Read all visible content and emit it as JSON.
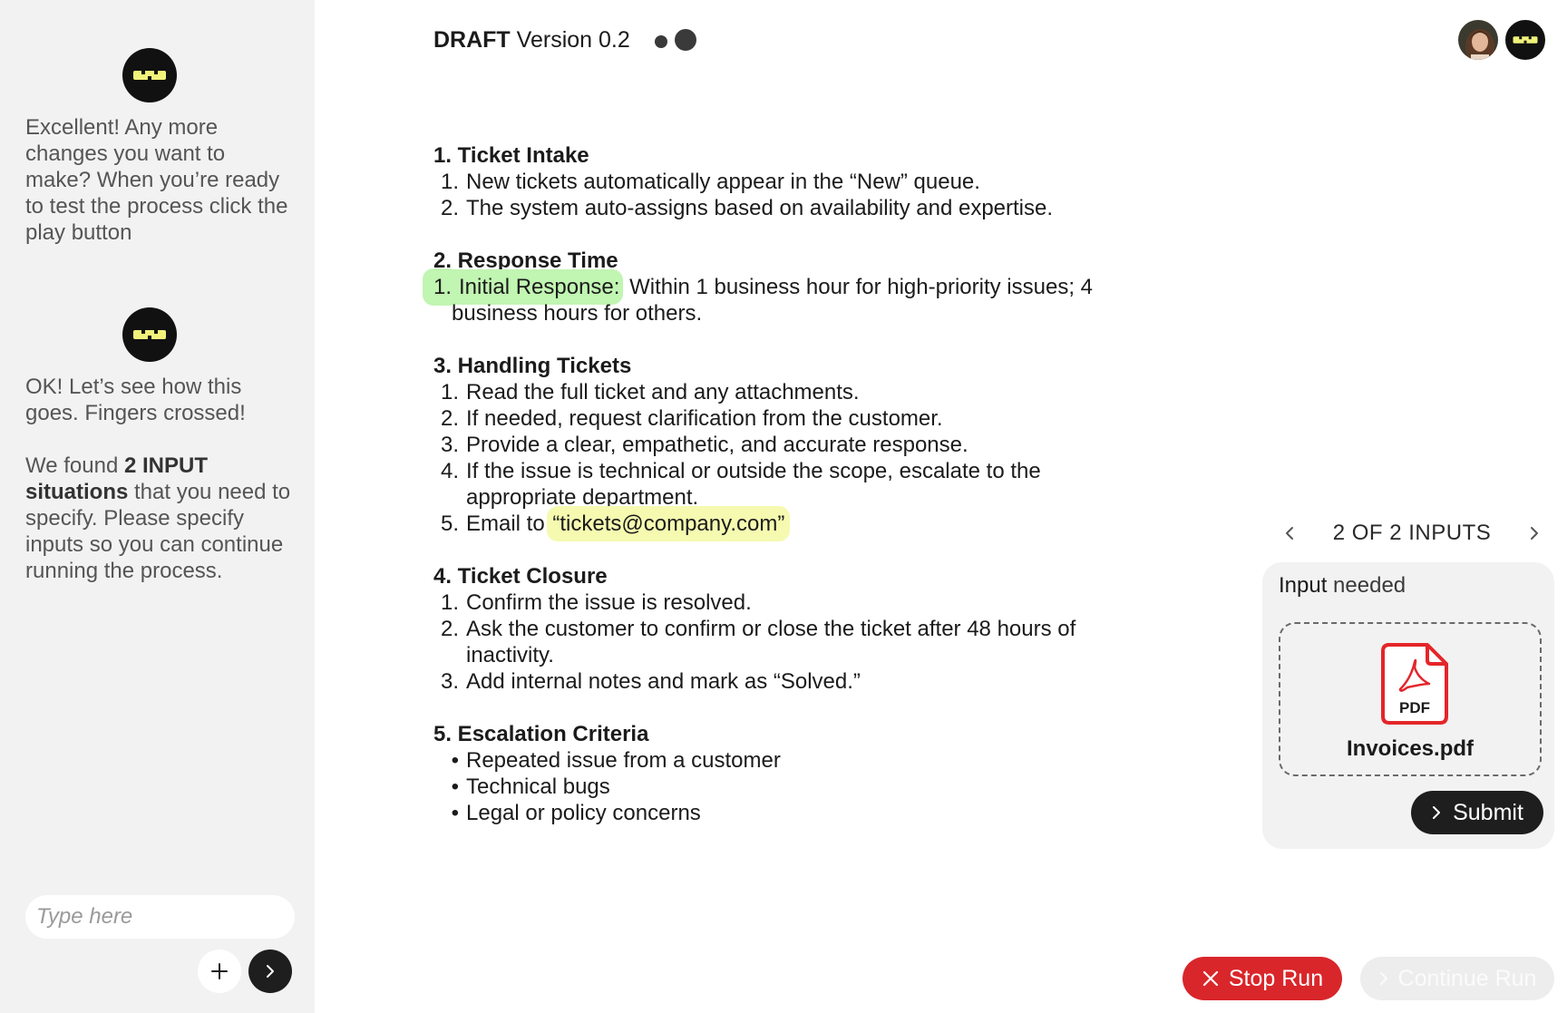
{
  "sidebar": {
    "messages": [
      {
        "text": "Excellent! Any more changes you want to make? When you’re ready to test the process click the play button"
      },
      {
        "line1": "OK! Let’s see how this goes. Fingers crossed!",
        "found_prefix": "We found ",
        "found_bold": "2 INPUT situations",
        "found_suffix": " that you need to specify. Please specify inputs so you can continue running the process."
      }
    ],
    "input_placeholder": "Type here",
    "plus_icon": "plus-icon",
    "send_icon": "chevron-right-icon"
  },
  "header": {
    "title_strong": "DRAFT",
    "title_rest": " Version 0.2"
  },
  "document": {
    "sections": [
      {
        "title": "1. Ticket Intake",
        "items": [
          {
            "num": "1.",
            "text": "New tickets automatically appear in the “New” queue."
          },
          {
            "num": "2.",
            "text": "The system auto-assigns based on availability and expertise."
          }
        ]
      },
      {
        "title": "2. Response Time",
        "items": [
          {
            "num": "1.",
            "highlight": "Initial Response:",
            "text": " Within 1 business hour for high-priority issues; 4 business hours for others."
          }
        ]
      },
      {
        "title": "3. Handling Tickets",
        "items": [
          {
            "num": "1.",
            "text": "Read the full ticket and any attachments."
          },
          {
            "num": "2.",
            "text": "If needed, request clarification from the customer."
          },
          {
            "num": "3.",
            "text": "Provide a clear, empathetic, and accurate response."
          },
          {
            "num": "4.",
            "text": "If the issue is technical or outside the scope, escalate to the appropriate department."
          },
          {
            "num": "5.",
            "prefix": "Email to ",
            "highlight": "“tickets@company.com”"
          }
        ]
      },
      {
        "title": "4. Ticket Closure",
        "items": [
          {
            "num": "1.",
            "text": "Confirm the issue is resolved."
          },
          {
            "num": "2.",
            "text": "Ask the customer to confirm or close the ticket after 48 hours of inactivity."
          },
          {
            "num": "3.",
            "text": "Add internal notes and mark as “Solved.”"
          }
        ]
      },
      {
        "title": "5. Escalation Criteria",
        "items": [
          {
            "num": "•",
            "text": "Repeated issue from a customer"
          },
          {
            "num": "•",
            "text": "Technical bugs"
          },
          {
            "num": "•",
            "text": "Legal or policy concerns"
          }
        ]
      }
    ],
    "highlight_colors": {
      "green": "#c1f5b2",
      "yellow": "#f5fab0"
    }
  },
  "input_panel": {
    "pager_label": "2 OF 2 INPUTS",
    "input_label_1": "Input",
    "input_label_2": " needed",
    "file_type_label": "PDF",
    "file_name": "Invoices.pdf",
    "submit_label": "Submit"
  },
  "actions": {
    "stop_label": "Stop Run",
    "continue_label": "Continue Run",
    "stop_color": "#d9262a"
  }
}
